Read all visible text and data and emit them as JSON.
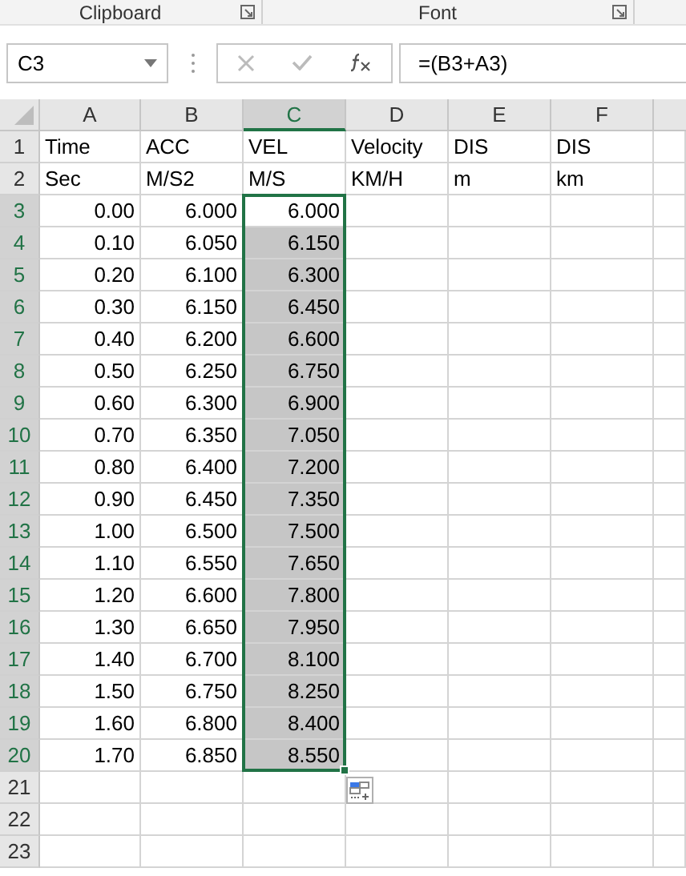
{
  "ribbon": {
    "groups": [
      {
        "label": "Clipboard"
      },
      {
        "label": "Font"
      }
    ]
  },
  "formula_bar": {
    "name_box": "C3",
    "formula": "=(B3+A3)"
  },
  "columns": [
    {
      "label": "A",
      "selected": false
    },
    {
      "label": "B",
      "selected": false
    },
    {
      "label": "C",
      "selected": true
    },
    {
      "label": "D",
      "selected": false
    },
    {
      "label": "E",
      "selected": false
    },
    {
      "label": "F",
      "selected": false
    }
  ],
  "rows": [
    {
      "number": "1",
      "kind": "label",
      "selected": false,
      "cells": [
        {
          "text": "Time",
          "selected": false
        },
        {
          "text": "ACC",
          "selected": false
        },
        {
          "text": "VEL",
          "selected": false
        },
        {
          "text": "Velocity",
          "selected": false
        },
        {
          "text": "DIS",
          "selected": false
        },
        {
          "text": "DIS",
          "selected": false
        }
      ]
    },
    {
      "number": "2",
      "kind": "label",
      "selected": false,
      "cells": [
        {
          "text": "Sec",
          "selected": false
        },
        {
          "text": "M/S2",
          "selected": false
        },
        {
          "text": "M/S",
          "selected": false
        },
        {
          "text": "KM/H",
          "selected": false
        },
        {
          "text": "m",
          "selected": false
        },
        {
          "text": "km",
          "selected": false
        }
      ]
    },
    {
      "number": "3",
      "kind": "number",
      "selected": true,
      "cells": [
        {
          "text": "0.00",
          "selected": false
        },
        {
          "text": "6.000",
          "selected": false
        },
        {
          "text": "6.000",
          "selected": false
        }
      ]
    },
    {
      "number": "4",
      "kind": "number",
      "selected": true,
      "cells": [
        {
          "text": "0.10",
          "selected": false
        },
        {
          "text": "6.050",
          "selected": false
        },
        {
          "text": "6.150",
          "selected": true
        }
      ]
    },
    {
      "number": "5",
      "kind": "number",
      "selected": true,
      "cells": [
        {
          "text": "0.20",
          "selected": false
        },
        {
          "text": "6.100",
          "selected": false
        },
        {
          "text": "6.300",
          "selected": true
        }
      ]
    },
    {
      "number": "6",
      "kind": "number",
      "selected": true,
      "cells": [
        {
          "text": "0.30",
          "selected": false
        },
        {
          "text": "6.150",
          "selected": false
        },
        {
          "text": "6.450",
          "selected": true
        }
      ]
    },
    {
      "number": "7",
      "kind": "number",
      "selected": true,
      "cells": [
        {
          "text": "0.40",
          "selected": false
        },
        {
          "text": "6.200",
          "selected": false
        },
        {
          "text": "6.600",
          "selected": true
        }
      ]
    },
    {
      "number": "8",
      "kind": "number",
      "selected": true,
      "cells": [
        {
          "text": "0.50",
          "selected": false
        },
        {
          "text": "6.250",
          "selected": false
        },
        {
          "text": "6.750",
          "selected": true
        }
      ]
    },
    {
      "number": "9",
      "kind": "number",
      "selected": true,
      "cells": [
        {
          "text": "0.60",
          "selected": false
        },
        {
          "text": "6.300",
          "selected": false
        },
        {
          "text": "6.900",
          "selected": true
        }
      ]
    },
    {
      "number": "10",
      "kind": "number",
      "selected": true,
      "cells": [
        {
          "text": "0.70",
          "selected": false
        },
        {
          "text": "6.350",
          "selected": false
        },
        {
          "text": "7.050",
          "selected": true
        }
      ]
    },
    {
      "number": "11",
      "kind": "number",
      "selected": true,
      "cells": [
        {
          "text": "0.80",
          "selected": false
        },
        {
          "text": "6.400",
          "selected": false
        },
        {
          "text": "7.200",
          "selected": true
        }
      ]
    },
    {
      "number": "12",
      "kind": "number",
      "selected": true,
      "cells": [
        {
          "text": "0.90",
          "selected": false
        },
        {
          "text": "6.450",
          "selected": false
        },
        {
          "text": "7.350",
          "selected": true
        }
      ]
    },
    {
      "number": "13",
      "kind": "number",
      "selected": true,
      "cells": [
        {
          "text": "1.00",
          "selected": false
        },
        {
          "text": "6.500",
          "selected": false
        },
        {
          "text": "7.500",
          "selected": true
        }
      ]
    },
    {
      "number": "14",
      "kind": "number",
      "selected": true,
      "cells": [
        {
          "text": "1.10",
          "selected": false
        },
        {
          "text": "6.550",
          "selected": false
        },
        {
          "text": "7.650",
          "selected": true
        }
      ]
    },
    {
      "number": "15",
      "kind": "number",
      "selected": true,
      "cells": [
        {
          "text": "1.20",
          "selected": false
        },
        {
          "text": "6.600",
          "selected": false
        },
        {
          "text": "7.800",
          "selected": true
        }
      ]
    },
    {
      "number": "16",
      "kind": "number",
      "selected": true,
      "cells": [
        {
          "text": "1.30",
          "selected": false
        },
        {
          "text": "6.650",
          "selected": false
        },
        {
          "text": "7.950",
          "selected": true
        }
      ]
    },
    {
      "number": "17",
      "kind": "number",
      "selected": true,
      "cells": [
        {
          "text": "1.40",
          "selected": false
        },
        {
          "text": "6.700",
          "selected": false
        },
        {
          "text": "8.100",
          "selected": true
        }
      ]
    },
    {
      "number": "18",
      "kind": "number",
      "selected": true,
      "cells": [
        {
          "text": "1.50",
          "selected": false
        },
        {
          "text": "6.750",
          "selected": false
        },
        {
          "text": "8.250",
          "selected": true
        }
      ]
    },
    {
      "number": "19",
      "kind": "number",
      "selected": true,
      "cells": [
        {
          "text": "1.60",
          "selected": false
        },
        {
          "text": "6.800",
          "selected": false
        },
        {
          "text": "8.400",
          "selected": true
        }
      ]
    },
    {
      "number": "20",
      "kind": "number",
      "selected": true,
      "cells": [
        {
          "text": "1.70",
          "selected": false
        },
        {
          "text": "6.850",
          "selected": false
        },
        {
          "text": "8.550",
          "selected": true
        }
      ]
    },
    {
      "number": "21",
      "kind": "empty",
      "selected": false
    },
    {
      "number": "22",
      "kind": "empty",
      "selected": false
    },
    {
      "number": "23",
      "kind": "empty",
      "selected": false
    }
  ]
}
